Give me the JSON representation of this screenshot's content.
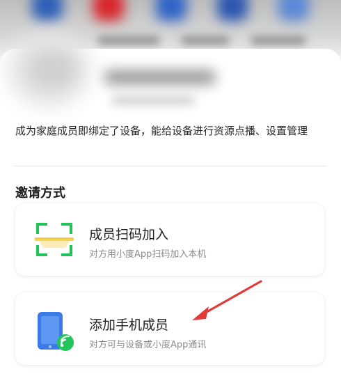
{
  "description": "成为家庭成员即绑定了设备，能给设备进行资源点播、设置管理",
  "section_title": "邀请方式",
  "invite_options": [
    {
      "title": "成员扫码加入",
      "subtitle": "对方用小度App扫码加入本机",
      "icon": "qr-scan-icon"
    },
    {
      "title": "添加手机成员",
      "subtitle": "对方可与设备或小度App通讯",
      "icon": "phone-signal-icon"
    }
  ],
  "colors": {
    "accent_green": "#21c45a",
    "scan_yellow": "#f5d24c",
    "phone_blue": "#3b7be8",
    "arrow_red": "#e03a3a"
  }
}
